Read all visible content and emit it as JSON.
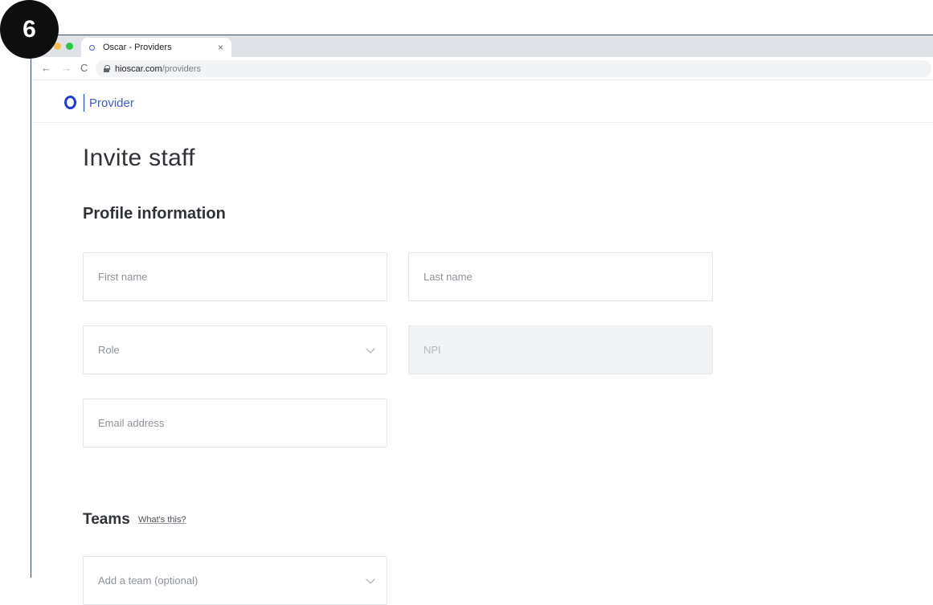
{
  "step_badge": "6",
  "browser": {
    "tab_title": "Oscar - Providers",
    "tab_close": "×",
    "nav_back": "←",
    "nav_forward": "→",
    "nav_reload": "C",
    "url_domain": "hioscar.com",
    "url_path": "/providers"
  },
  "site": {
    "logo_text": "Provider"
  },
  "form": {
    "page_title": "Invite staff",
    "section_title": "Profile information",
    "first_name_placeholder": "First name",
    "last_name_placeholder": "Last name",
    "role_placeholder": "Role",
    "npi_placeholder": "NPI",
    "email_placeholder": "Email address",
    "teams_title": "Teams",
    "teams_help_link": "What's this?",
    "team_placeholder": "Add a team (optional)"
  },
  "colors": {
    "brand": "#1b3fd6",
    "text": "#2f3338",
    "placeholder": "#8e939a"
  }
}
